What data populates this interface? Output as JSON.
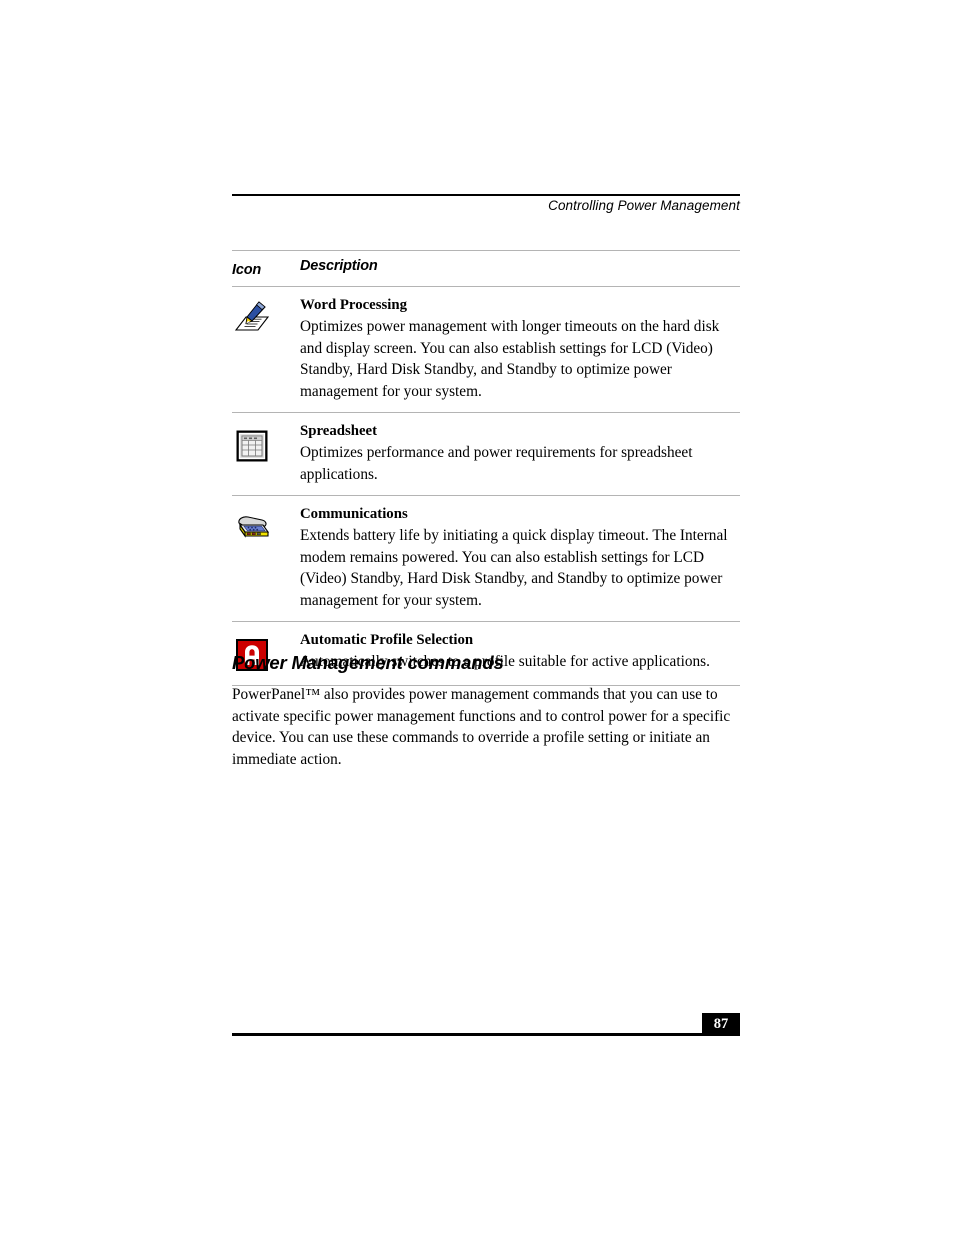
{
  "header": {
    "running_title": "Controlling Power Management"
  },
  "table": {
    "columns": [
      "Icon",
      "Description"
    ],
    "rows": [
      {
        "icon_name": "word-processing-icon",
        "title": "Word Processing",
        "body": "Optimizes power management with longer timeouts on the hard disk and display screen. You can also establish settings for LCD (Video) Standby, Hard Disk Standby, and Standby to optimize power management for your system."
      },
      {
        "icon_name": "spreadsheet-icon",
        "title": "Spreadsheet",
        "body": "Optimizes performance and power requirements for spreadsheet applications."
      },
      {
        "icon_name": "communications-icon",
        "title": "Communications",
        "body": "Extends battery life by initiating a quick display timeout. The Internal modem remains powered. You can also establish settings for LCD (Video) Standby, Hard Disk Standby, and Standby to optimize power management for your system."
      },
      {
        "icon_name": "automatic-profile-selection-icon",
        "title": "Automatic Profile Selection",
        "body": "Automatically switches to a profile suitable for active applications."
      }
    ]
  },
  "section": {
    "heading": "Power Management commands",
    "paragraph": "PowerPanel™ also provides power management commands that you can use to activate specific power management functions and to control power for a specific device. You can use these commands to override a profile setting or initiate an immediate action."
  },
  "footer": {
    "page_number": "87"
  },
  "colors": {
    "text": "#000000",
    "rule_thin": "#b4b4b4",
    "rule_thick": "#000000",
    "page_badge_bg": "#000000",
    "page_badge_text": "#ffffff",
    "auto_profile_red": "#cc0000",
    "comm_yellow": "#f2e300",
    "comm_blue": "#5a6fc0"
  }
}
